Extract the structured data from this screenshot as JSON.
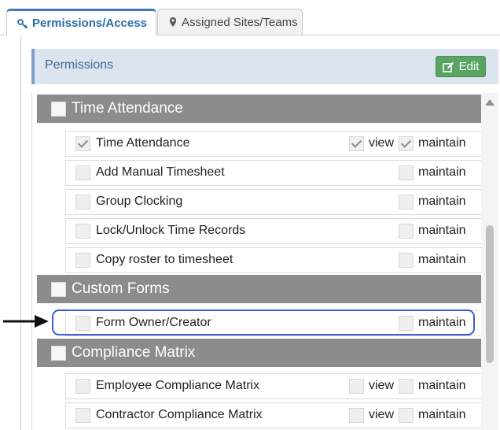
{
  "tabs": [
    {
      "label": "Permissions/Access",
      "icon": "key-icon",
      "active": true
    },
    {
      "label": "Assigned Sites/Teams",
      "icon": "map-marker-icon",
      "active": false
    }
  ],
  "panel": {
    "title": "Permissions",
    "edit_label": "Edit",
    "edit_icon": "edit-icon"
  },
  "colors": {
    "accent": "#2a6fa8",
    "edit_green": "#5aa463",
    "category_gray": "#8c8c8c",
    "highlight_blue": "#3f5bd6"
  },
  "categories": [
    {
      "label": "Time Attendance"
    },
    {
      "label": "Custom Forms"
    },
    {
      "label": "Compliance Matrix"
    }
  ],
  "rows": [
    {
      "label": "Time Attendance",
      "checked": true,
      "view": "view",
      "view_checked": true,
      "maintain": "maintain",
      "maintain_checked": true
    },
    {
      "label": "Add Manual Timesheet",
      "checked": false,
      "maintain": "maintain",
      "maintain_checked": false
    },
    {
      "label": "Group Clocking",
      "checked": false,
      "maintain": "maintain",
      "maintain_checked": false
    },
    {
      "label": "Lock/Unlock Time Records",
      "checked": false,
      "maintain": "maintain",
      "maintain_checked": false
    },
    {
      "label": "Copy roster to timesheet",
      "checked": false,
      "maintain": "maintain",
      "maintain_checked": false
    },
    {
      "label": "Form Owner/Creator",
      "checked": false,
      "maintain": "maintain",
      "maintain_checked": false
    },
    {
      "label": "Employee Compliance Matrix",
      "checked": false,
      "view": "view",
      "view_checked": false,
      "maintain": "maintain",
      "maintain_checked": false
    },
    {
      "label": "Contractor Compliance Matrix",
      "checked": false,
      "view": "view",
      "view_checked": false,
      "maintain": "maintain",
      "maintain_checked": false
    }
  ]
}
